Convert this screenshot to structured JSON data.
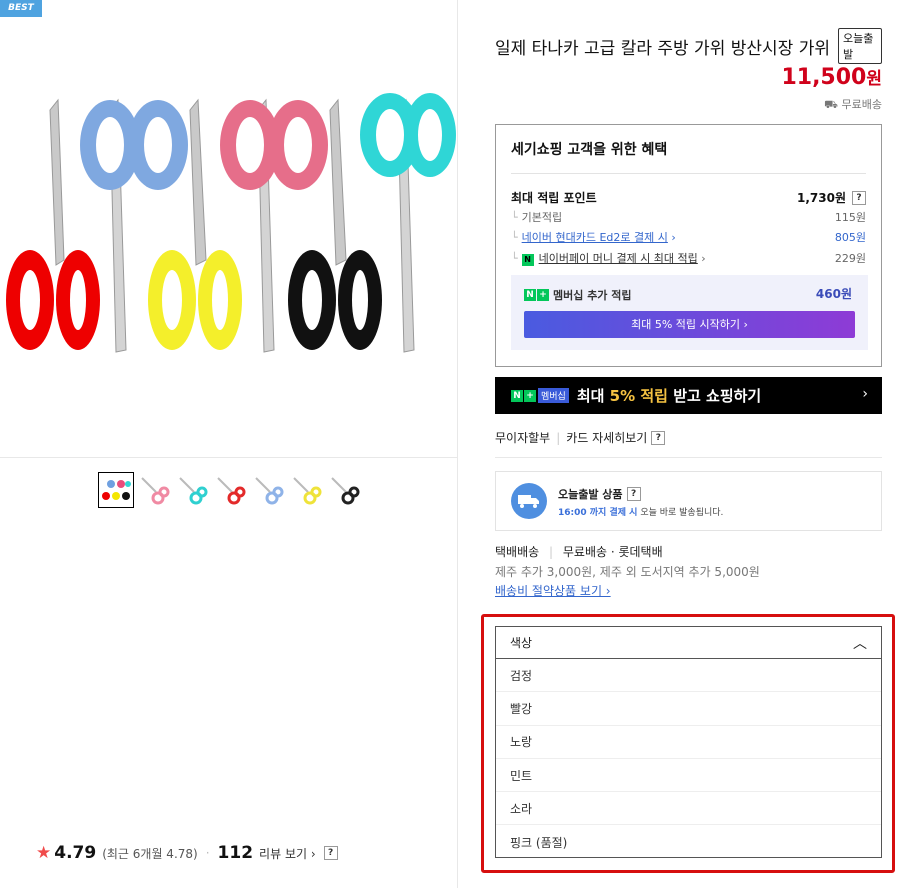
{
  "badge": "BEST",
  "product": {
    "title": "일제 타나카 고급 칼라 주방 가위 방산시장 가위",
    "today_badge": "오늘출발",
    "price": "11,500",
    "price_unit": "원",
    "free_shipping": "무료배송"
  },
  "thumbnails": [
    {
      "name": "thumb-all",
      "colors": [
        "#e00",
        "#6fa0e0",
        "#f4e600",
        "#e84d7c",
        "#111",
        "#32d6d6"
      ]
    },
    {
      "name": "thumb-pink",
      "colors": [
        "#f08aa3"
      ]
    },
    {
      "name": "thumb-mint",
      "colors": [
        "#2fd0d0"
      ]
    },
    {
      "name": "thumb-red",
      "colors": [
        "#e32a2a"
      ]
    },
    {
      "name": "thumb-blue",
      "colors": [
        "#8fb3e8"
      ]
    },
    {
      "name": "thumb-yellow",
      "colors": [
        "#efe33a"
      ]
    },
    {
      "name": "thumb-black",
      "colors": [
        "#222"
      ]
    }
  ],
  "rating": {
    "score": "4.79",
    "recent": "(최근 6개월 4.78)",
    "dot": "·",
    "review_count": "112",
    "review_link": "리뷰 보기 ›",
    "help": "?"
  },
  "benefit": {
    "title": "세기쇼핑 고객을 위한 혜택",
    "max_points_label": "최대 적립 포인트",
    "max_points_value": "1,730원",
    "help": "?",
    "basic_label": "기본적립",
    "basic_value": "115원",
    "card_label": "네이버 현대카드 Ed2로 결제 시",
    "card_arrow": "›",
    "card_value": "805원",
    "npay_label": "네이버페이 머니 결제 시 최대 적립",
    "npay_arrow": "›",
    "npay_value": "229원",
    "member_label": "멤버십 추가 적립",
    "member_points": "460원",
    "member_cta": "최대 5% 적립 시작하기 ›"
  },
  "banner": {
    "membership": "멤버십",
    "text_pre": "최대 ",
    "text_highlight": "5% 적립",
    "text_post": " 받고 쇼핑하기",
    "arrow": "›"
  },
  "installment": {
    "no_interest": "무이자할부",
    "card_detail": "카드 자세히보기",
    "help": "?"
  },
  "today_ship": {
    "title": "오늘출발 상품",
    "help": "?",
    "time": "16:00 까지 결제 시",
    "desc": " 오늘 바로 발송됩니다."
  },
  "delivery": {
    "type": "택배배송",
    "method": "무료배송 · 롯데택배",
    "extra": "제주 추가 3,000원, 제주 외 도서지역 추가 5,000원",
    "link": "배송비 절약상품 보기 ›"
  },
  "option_select": {
    "label": "색상",
    "options": [
      "검정",
      "빨강",
      "노랑",
      "민트",
      "소라",
      "핑크 (품절)"
    ]
  }
}
